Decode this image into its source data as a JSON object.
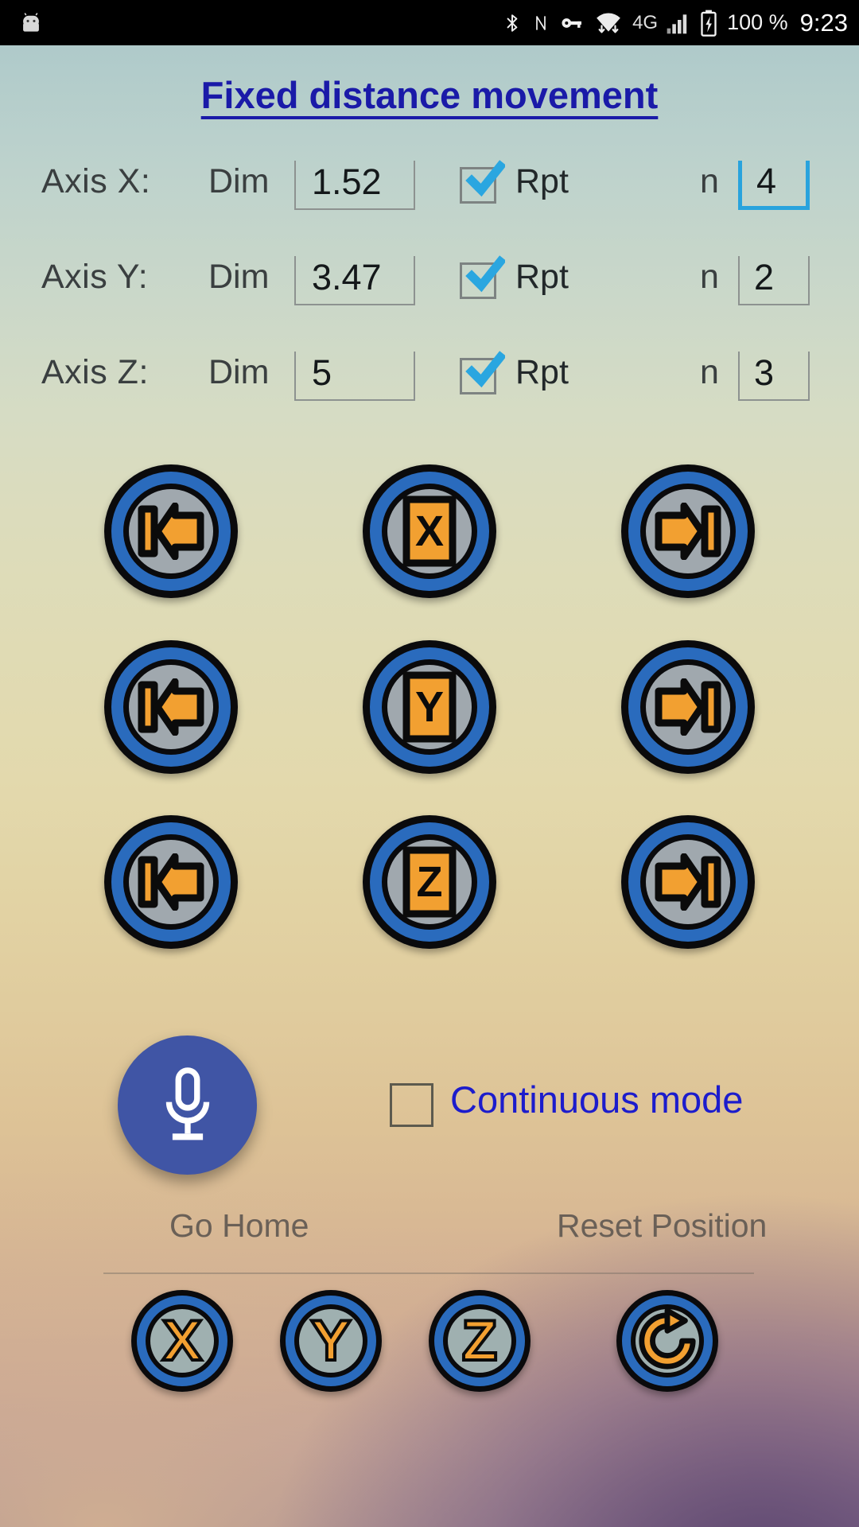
{
  "status_bar": {
    "left_icons": [
      "android-robot-icon"
    ],
    "right_icons": [
      "bluetooth-icon",
      "nfc-icon",
      "vpn-key-icon",
      "wifi-icon",
      "cell-signal-icon",
      "battery-charging-icon"
    ],
    "network_type": "4G",
    "battery_percent": "100 %",
    "time": "9:23"
  },
  "header": {
    "title": "Fixed distance movement"
  },
  "axes": [
    {
      "label": "Axis X:",
      "dim_label": "Dim",
      "dim_value": "1.52",
      "rpt_label": "Rpt",
      "rpt_checked": true,
      "n_label": "n",
      "n_value": "4",
      "n_focused": true
    },
    {
      "label": "Axis Y:",
      "dim_label": "Dim",
      "dim_value": "3.47",
      "rpt_label": "Rpt",
      "rpt_checked": true,
      "n_label": "n",
      "n_value": "2",
      "n_focused": false
    },
    {
      "label": "Axis Z:",
      "dim_label": "Dim",
      "dim_value": "5",
      "rpt_label": "Rpt",
      "rpt_checked": true,
      "n_label": "n",
      "n_value": "3",
      "n_focused": false
    }
  ],
  "jog_grid": [
    {
      "axis": "X",
      "left_icon": "skip-previous-arrow-icon",
      "center_letter": "X",
      "right_icon": "skip-next-arrow-icon"
    },
    {
      "axis": "Y",
      "left_icon": "skip-previous-arrow-icon",
      "center_letter": "Y",
      "right_icon": "skip-next-arrow-icon"
    },
    {
      "axis": "Z",
      "left_icon": "skip-previous-arrow-icon",
      "center_letter": "Z",
      "right_icon": "skip-next-arrow-icon"
    }
  ],
  "voice": {
    "icon": "microphone-icon",
    "color": "#4055a5"
  },
  "continuous_mode": {
    "label": "Continuous mode",
    "checked": false,
    "color": "#1c1ccc"
  },
  "footer": {
    "go_home_label": "Go Home",
    "reset_position_label": "Reset Position",
    "home_buttons": [
      {
        "letter": "X",
        "name": "go-home-x"
      },
      {
        "letter": "Y",
        "name": "go-home-y"
      },
      {
        "letter": "Z",
        "name": "go-home-z"
      }
    ],
    "reset_button": {
      "icon": "refresh-rotate-icon"
    }
  },
  "theme": {
    "accent_blue": "#2a6bbd",
    "icon_orange": "#F2A031",
    "title_blue": "#1a1aa8",
    "focus_blue": "#29a3dd",
    "button_face": "#a0a8ae"
  }
}
